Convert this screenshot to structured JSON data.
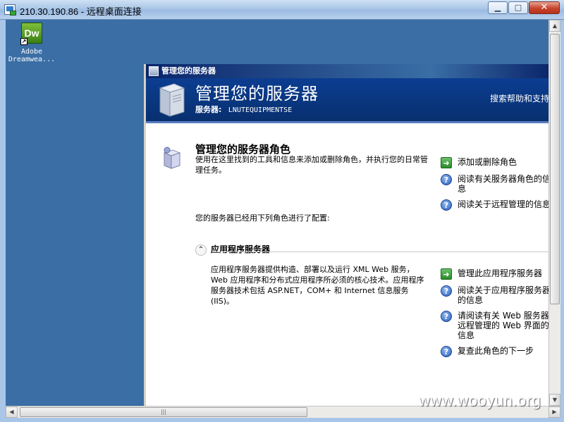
{
  "rdp": {
    "title": "210.30.190.86 - 远程桌面连接",
    "minimize_glyph": "▁",
    "maximize_glyph": "□",
    "close_glyph": "✕",
    "icon": "remote-desktop-icon"
  },
  "desktop": {
    "icon_label_line1": "Adobe",
    "icon_label_line2": "Dreamwea...",
    "icon_tile_text": "Dw"
  },
  "manager": {
    "window_title": "管理您的服务器",
    "header_title": "管理您的服务器",
    "server_label": "服务器:",
    "server_name": "LNUTEQUIPMENTSE",
    "help_link": "搜索帮助和支持",
    "section_title": "管理您的服务器角色",
    "section_desc": "使用在这里找到的工具和信息来添加或删除角色，并执行您的日常管理任务。",
    "configured_text": "您的服务器已经用下列角色进行了配置:",
    "top_actions": [
      {
        "icon": "green-arrow-icon",
        "label": "添加或删除角色"
      },
      {
        "icon": "help-icon",
        "label": "阅读有关服务器角色的信",
        "label2": "息"
      },
      {
        "icon": "help-icon",
        "label": "阅读关于远程管理的信息"
      }
    ],
    "role": {
      "collapse_glyph": "⌃",
      "name": "应用程序服务器",
      "desc": "应用程序服务器提供构造、部署以及运行 XML Web 服务，Web 应用程序和分布式应用程序所必须的核心技术。应用程序服务器技术包括 ASP.NET，COM+ 和 Internet 信息服务(IIS)。"
    },
    "role_actions": [
      {
        "icon": "green-arrow-icon",
        "label": "管理此应用程序服务器"
      },
      {
        "icon": "help-icon",
        "label": "阅读关于应用程序服务器",
        "label2": "的信息"
      },
      {
        "icon": "help-icon",
        "label": "请阅读有关 Web 服务器",
        "label2": "远程管理的 Web 界面的",
        "label3": "信息"
      },
      {
        "icon": "help-icon",
        "label": "复查此角色的下一步"
      }
    ]
  },
  "scrollbars": {
    "up": "▲",
    "down": "▼",
    "left": "◀",
    "right": "▶",
    "grip": "|||"
  },
  "watermark": "www.wooyun.org"
}
